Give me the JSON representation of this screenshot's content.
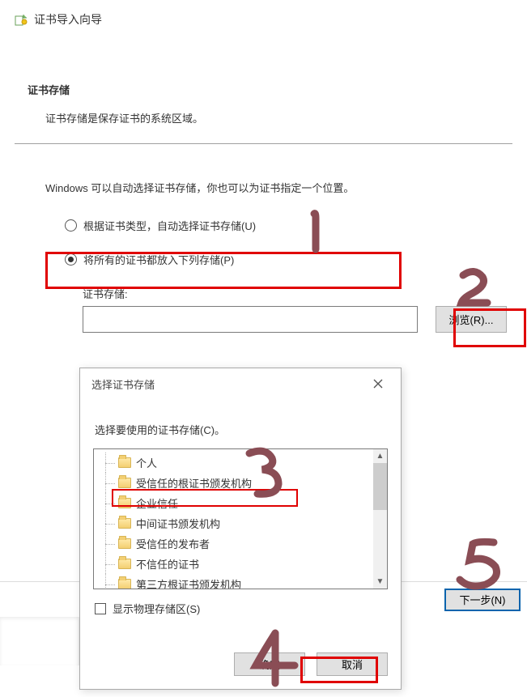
{
  "wizard": {
    "title": "证书导入向导",
    "section": "证书存储",
    "helper": "证书存储是保存证书的系统区域。",
    "body": "Windows 可以自动选择证书存储，你也可以为证书指定一个位置。",
    "radio_auto": "根据证书类型，自动选择证书存储(U)",
    "radio_place": "将所有的证书都放入下列存储(P)",
    "store_label": "证书存储:",
    "store_value": "",
    "browse": "浏览(R)...",
    "next": "下一步(N)"
  },
  "dialog": {
    "title": "选择证书存储",
    "prompt": "选择要使用的证书存储(C)。",
    "show_physical": "显示物理存储区(S)",
    "ok": "确定",
    "cancel": "取消",
    "items": [
      "个人",
      "受信任的根证书颁发机构",
      "企业信任",
      "中间证书颁发机构",
      "受信任的发布者",
      "不信任的证书",
      "第三方根证书颁发机构"
    ]
  }
}
